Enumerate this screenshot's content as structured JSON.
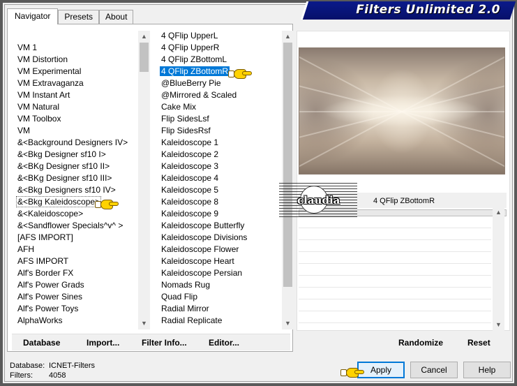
{
  "app": {
    "title": "Filters Unlimited 2.0"
  },
  "tabs": [
    {
      "label": "Navigator"
    },
    {
      "label": "Presets"
    },
    {
      "label": "About"
    }
  ],
  "categories": [
    "VM 1",
    "VM Distortion",
    "VM Experimental",
    "VM Extravaganza",
    "VM Instant Art",
    "VM Natural",
    "VM Toolbox",
    "VM",
    "&<Background Designers IV>",
    "&<Bkg Designer sf10 I>",
    "&<BKg Designer sf10 II>",
    "&<BKg Designer sf10 III>",
    "&<Bkg Designers sf10 IV>",
    "&<Bkg Kaleidoscope>",
    "&<Kaleidoscope>",
    "&<Sandflower Specials^v^ >",
    "[AFS IMPORT]",
    "AFH",
    "AFS IMPORT",
    "Alf's Border FX",
    "Alf's Power Grads",
    "Alf's Power Sines",
    "Alf's Power Toys",
    "AlphaWorks"
  ],
  "selected_category": "&<Bkg Kaleidoscope>",
  "filters": [
    "4 QFlip UpperL",
    "4 QFlip UpperR",
    "4 QFlip ZBottomL",
    "4 QFlip ZBottomR",
    "@BlueBerry Pie",
    "@Mirrored & Scaled",
    "Cake Mix",
    "Flip SidesLsf",
    "Flip SidesRsf",
    "Kaleidoscope 1",
    "Kaleidoscope 2",
    "Kaleidoscope 3",
    "Kaleidoscope 4",
    "Kaleidoscope 5",
    "Kaleidoscope 8",
    "Kaleidoscope 9",
    "Kaleidoscope Butterfly",
    "Kaleidoscope Divisions",
    "Kaleidoscope Flower",
    "Kaleidoscope Heart",
    "Kaleidoscope Persian",
    "Nomads Rug",
    "Quad Flip",
    "Radial Mirror",
    "Radial Replicate"
  ],
  "selected_filter": "4 QFlip ZBottomR",
  "preview": {
    "filter_name": "4 QFlip ZBottomR"
  },
  "watermark": {
    "text": "claudia"
  },
  "toolbar": {
    "database": "Database",
    "import": "Import...",
    "filter_info": "Filter Info...",
    "editor": "Editor...",
    "randomize": "Randomize",
    "reset": "Reset"
  },
  "info": {
    "database_label": "Database:",
    "database_value": "ICNET-Filters",
    "filters_label": "Filters:",
    "filters_value": "4058"
  },
  "buttons": {
    "apply": "Apply",
    "cancel": "Cancel",
    "help": "Help"
  },
  "icons": {
    "scroll_up": "▲",
    "scroll_down": "▼",
    "pointer_hand": "pointing-hand-icon"
  }
}
